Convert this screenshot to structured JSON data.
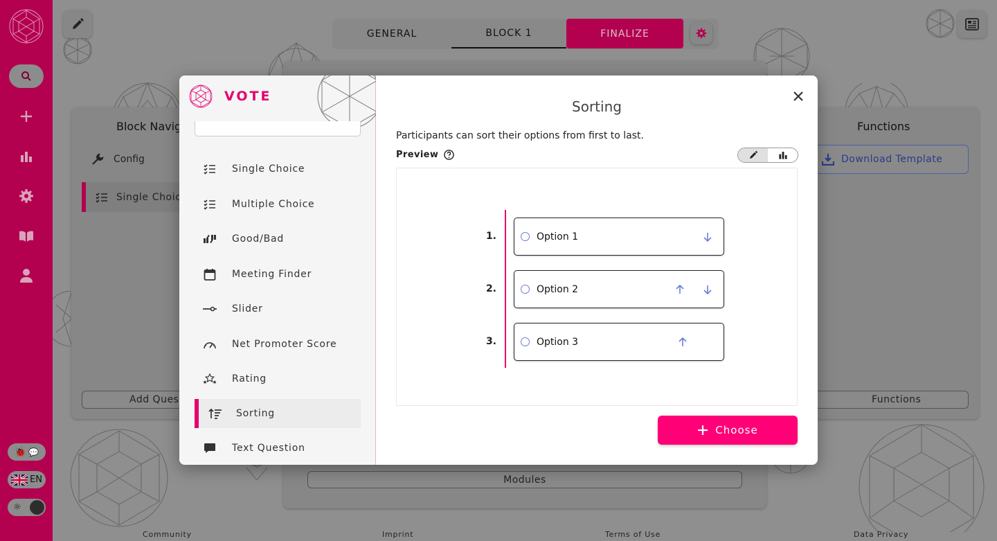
{
  "app": {
    "tabs": [
      {
        "label": "GENERAL"
      },
      {
        "label": "BLOCK 1"
      },
      {
        "label": "FINALIZE"
      }
    ],
    "language": "EN"
  },
  "background": {
    "left_panel_title": "Block Navig",
    "config_label": "Config",
    "single_choice_label": "Single Choic",
    "add_question_label": "Add Ques",
    "functions_title": "Functions",
    "download_template_label": "Download Template",
    "functions_button_label": "Functions",
    "modules_button_label": "Modules"
  },
  "footer": {
    "community": "Community",
    "imprint": "Imprint",
    "terms": "Terms of Use",
    "privacy": "Data Privacy"
  },
  "modal": {
    "brand": "VOTE",
    "modules": [
      {
        "label": "Single Choice",
        "icon": "checklist-icon"
      },
      {
        "label": "Multiple Choice",
        "icon": "checklist-icon"
      },
      {
        "label": "Good/Bad",
        "icon": "thumbs-icon"
      },
      {
        "label": "Meeting Finder",
        "icon": "calendar-icon"
      },
      {
        "label": "Slider",
        "icon": "slider-icon"
      },
      {
        "label": "Net Promoter Score",
        "icon": "gauge-icon"
      },
      {
        "label": "Rating",
        "icon": "stars-icon"
      },
      {
        "label": "Sorting",
        "icon": "sort-icon",
        "active": true
      },
      {
        "label": "Text Question",
        "icon": "chat-icon"
      }
    ],
    "title": "Sorting",
    "description": "Participants can sort their options from first to last.",
    "preview_label": "Preview",
    "options": [
      {
        "rank": "1.",
        "label": "Option 1"
      },
      {
        "rank": "2.",
        "label": "Option 2"
      },
      {
        "rank": "3.",
        "label": "Option 3"
      }
    ],
    "choose_label": "Choose"
  },
  "colors": {
    "brand": "#e6006e",
    "rail": "#b3004f",
    "choose_button": "#ff0077",
    "arrow": "#6b7fd6"
  }
}
